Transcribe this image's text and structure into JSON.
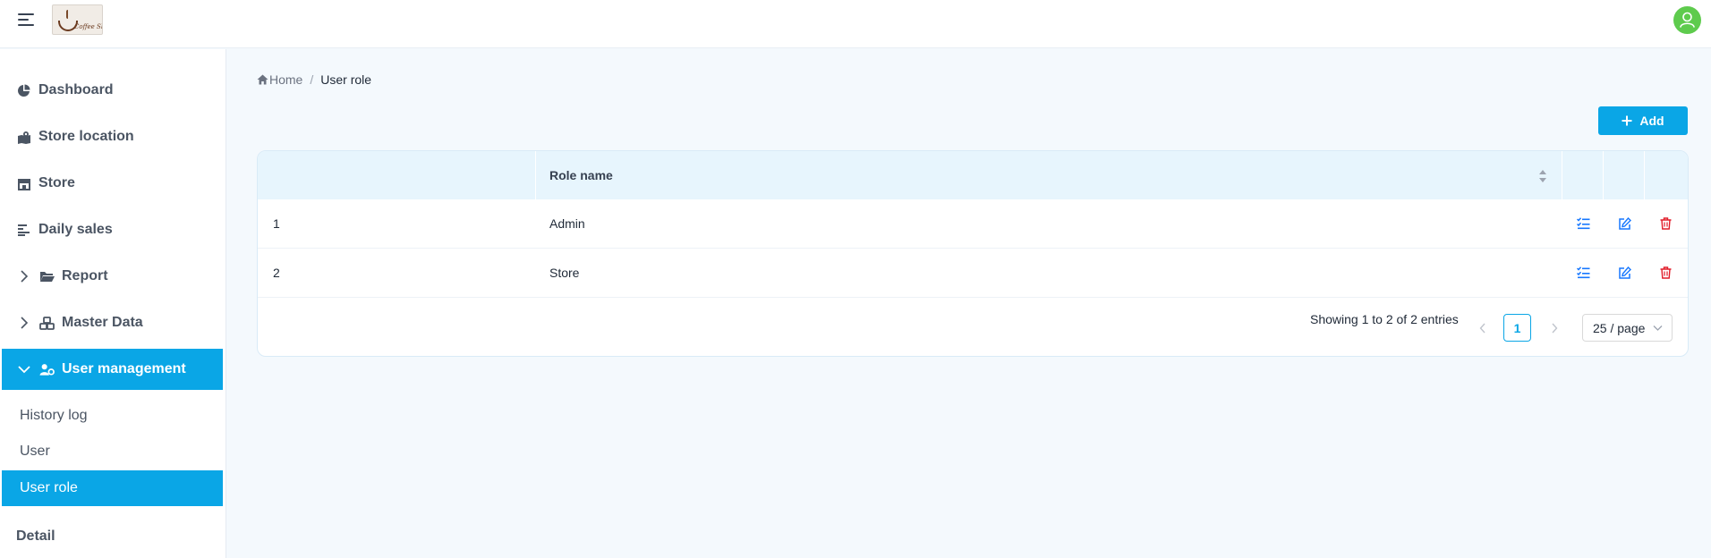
{
  "header": {
    "logo_text": "Coffee Shop",
    "menu_icon": "hamburger-icon",
    "user_icon": "user-icon",
    "avatar_color": "#5ecb4d"
  },
  "sidebar": {
    "accent_color": "#0aa6e6",
    "items": [
      {
        "label": "Dashboard",
        "icon": "pie-chart-icon"
      },
      {
        "label": "Store location",
        "icon": "map-icon"
      },
      {
        "label": "Store",
        "icon": "shop-icon"
      },
      {
        "label": "Daily sales",
        "icon": "bar-list-icon"
      },
      {
        "label": "Report",
        "icon": "folder-icon",
        "expandable": true
      },
      {
        "label": "Master Data",
        "icon": "cubes-icon",
        "expandable": true
      },
      {
        "label": "User management",
        "icon": "user-gear-icon",
        "expandable": true,
        "expanded": true
      }
    ],
    "sub_items": [
      {
        "label": "History log"
      },
      {
        "label": "User"
      },
      {
        "label": "User role"
      }
    ],
    "footer_label": "Detail"
  },
  "breadcrumb": {
    "home": "Home",
    "separator": "/",
    "current": "User role"
  },
  "toolbar": {
    "add_label": "Add"
  },
  "table": {
    "columns": [
      "",
      "Role name"
    ],
    "rows": [
      {
        "no": "1",
        "role": "Admin"
      },
      {
        "no": "2",
        "role": "Store"
      }
    ],
    "row_actions": [
      "permissions-icon",
      "edit-icon",
      "delete-icon"
    ]
  },
  "pagination": {
    "info": "Showing 1 to 2 of 2 entries",
    "current_page": "1",
    "page_size": "25 / page"
  }
}
